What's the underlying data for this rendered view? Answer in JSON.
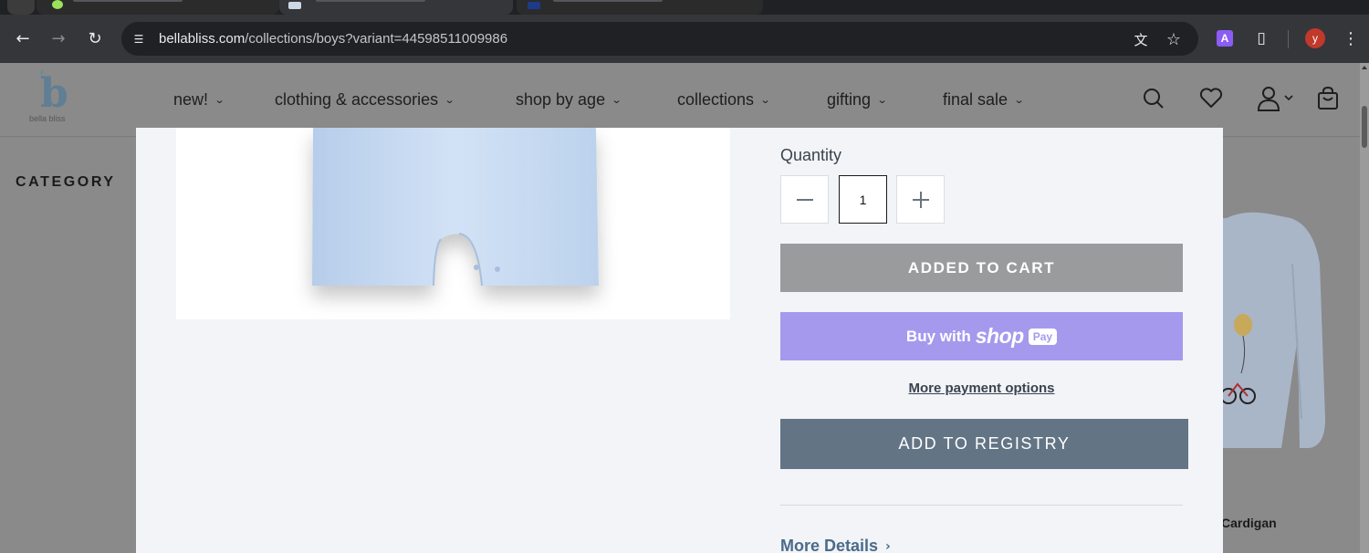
{
  "browser": {
    "url_host": "bellabliss.com",
    "url_path": "/collections/boys?variant=44598511009986",
    "profile_initial": "y",
    "extension_label": "A"
  },
  "site": {
    "logo_text": "bella bliss",
    "nav": [
      {
        "label": "new!"
      },
      {
        "label": "clothing & accessories"
      },
      {
        "label": "shop by age"
      },
      {
        "label": "collections"
      },
      {
        "label": "gifting"
      },
      {
        "label": "final sale"
      }
    ],
    "sidebar_heading": "CATEGORY",
    "peek_product_name": "Cardigan"
  },
  "modal": {
    "quantity_label": "Quantity",
    "quantity_value": "1",
    "added_to_cart_label": "ADDED TO CART",
    "shop_pay": {
      "buy_with": "Buy with",
      "shop": "shop",
      "pay": "Pay"
    },
    "more_payment_options": "More payment options",
    "add_to_registry_label": "ADD TO REGISTRY",
    "more_details_label": "More Details"
  },
  "colors": {
    "shop_pay_purple": "#a599ee",
    "registry_slate": "#637485",
    "added_gray": "#9a9b9c",
    "overlay_gray": "#8a8a8a"
  }
}
